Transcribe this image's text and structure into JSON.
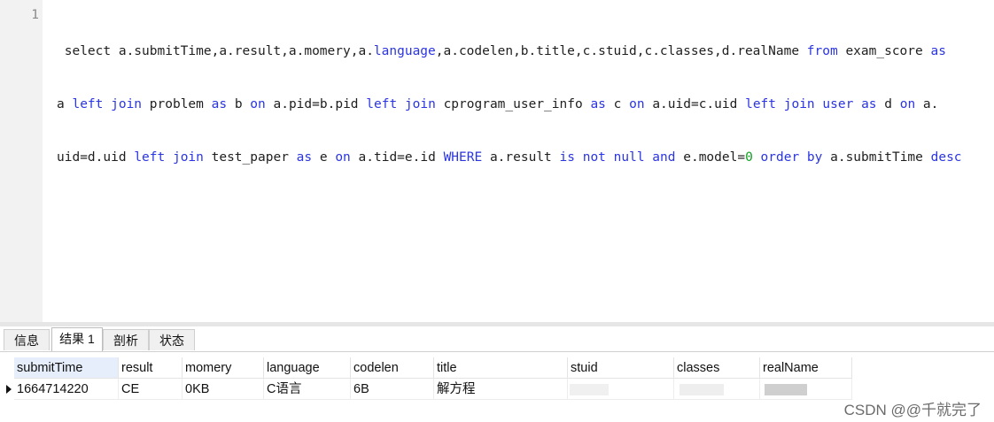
{
  "editor": {
    "line_number": "1",
    "code": {
      "line1": [
        {
          "t": " select a.submitTime,a.result,a.momery,a.",
          "k": ""
        },
        {
          "t": "language",
          "k": "kw"
        },
        {
          "t": ",a.codelen,b.title,c.stuid,c.classes,d.realName ",
          "k": ""
        },
        {
          "t": "from",
          "k": "kw"
        },
        {
          "t": " exam_score ",
          "k": ""
        },
        {
          "t": "as",
          "k": "kw"
        }
      ],
      "line2": [
        {
          "t": "a ",
          "k": ""
        },
        {
          "t": "left join",
          "k": "kw"
        },
        {
          "t": " problem ",
          "k": ""
        },
        {
          "t": "as",
          "k": "kw"
        },
        {
          "t": " b ",
          "k": ""
        },
        {
          "t": "on",
          "k": "kw"
        },
        {
          "t": " a.pid=b.pid ",
          "k": ""
        },
        {
          "t": "left join",
          "k": "kw"
        },
        {
          "t": " cprogram_user_info ",
          "k": ""
        },
        {
          "t": "as",
          "k": "kw"
        },
        {
          "t": " c ",
          "k": ""
        },
        {
          "t": "on",
          "k": "kw"
        },
        {
          "t": " a.uid=c.uid ",
          "k": ""
        },
        {
          "t": "left join",
          "k": "kw"
        },
        {
          "t": " ",
          "k": ""
        },
        {
          "t": "user",
          "k": "kw"
        },
        {
          "t": " ",
          "k": ""
        },
        {
          "t": "as",
          "k": "kw"
        },
        {
          "t": " d ",
          "k": ""
        },
        {
          "t": "on",
          "k": "kw"
        },
        {
          "t": " a.",
          "k": ""
        }
      ],
      "line3": [
        {
          "t": "uid=d.uid ",
          "k": ""
        },
        {
          "t": "left join",
          "k": "kw"
        },
        {
          "t": " test_paper ",
          "k": ""
        },
        {
          "t": "as",
          "k": "kw"
        },
        {
          "t": " e ",
          "k": ""
        },
        {
          "t": "on",
          "k": "kw"
        },
        {
          "t": " a.tid=e.id ",
          "k": ""
        },
        {
          "t": "WHERE",
          "k": "kw"
        },
        {
          "t": " a.result ",
          "k": ""
        },
        {
          "t": "is not null",
          "k": "kw"
        },
        {
          "t": " ",
          "k": ""
        },
        {
          "t": "and",
          "k": "kw"
        },
        {
          "t": " e.model=",
          "k": ""
        },
        {
          "t": "0",
          "k": "num"
        },
        {
          "t": " ",
          "k": ""
        },
        {
          "t": "order by",
          "k": "kw"
        },
        {
          "t": " a.submitTime ",
          "k": ""
        },
        {
          "t": "desc",
          "k": "kw"
        }
      ]
    }
  },
  "tabs": [
    {
      "label": "信息",
      "active": false
    },
    {
      "label": "结果 1",
      "active": true
    },
    {
      "label": "剖析",
      "active": false
    },
    {
      "label": "状态",
      "active": false
    }
  ],
  "grid": {
    "columns": [
      "submitTime",
      "result",
      "momery",
      "language",
      "codelen",
      "title",
      "stuid",
      "classes",
      "realName"
    ],
    "rows": [
      [
        "1664714220",
        "CE",
        "0KB",
        "C语言",
        "6B",
        "解方程",
        "",
        "",
        ""
      ]
    ]
  },
  "watermark": "CSDN @@千就完了",
  "colors": {
    "keyword": "#2b35e0",
    "number": "#10a020",
    "selected_header": "#e6eefb"
  }
}
